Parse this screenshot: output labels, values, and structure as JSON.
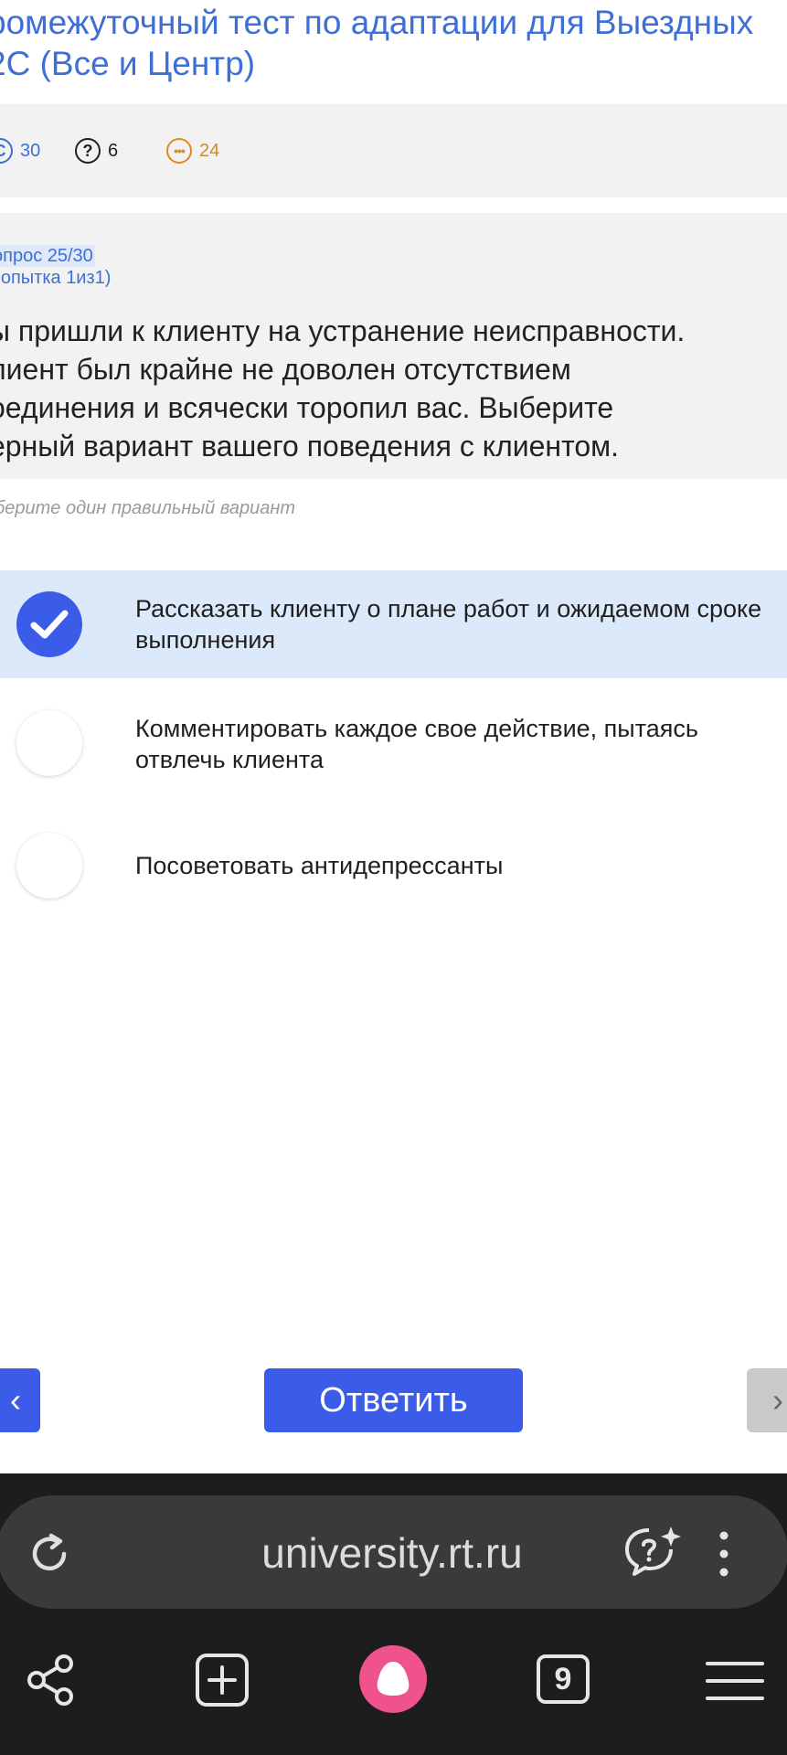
{
  "page": {
    "title": "ромежуточный тест по адаптации для Выездных\n2С (Все и Центр)"
  },
  "stats": {
    "questions_total": "30",
    "unanswered": "6",
    "remaining": "24"
  },
  "question": {
    "number": "опрос 25/30",
    "attempt": "попытка 1из1)",
    "text": "ы пришли к клиенту на устранение неисправности.\nлиент был крайне не доволен отсутствием\nоединения и всячески торопил вас. Выберите\nерный вариант вашего поведения с клиентом.",
    "hint": "берите один правильный вариант"
  },
  "options": [
    {
      "label": "Рассказать клиенту о плане работ и ожидаемом сроке выполнения",
      "selected": true
    },
    {
      "label": "Комментировать каждое свое действие, пытаясь отвлечь клиента",
      "selected": false
    },
    {
      "label": "Посоветовать антидепрессанты",
      "selected": false
    }
  ],
  "actions": {
    "submit_label": "Ответить",
    "prev_glyph": "‹",
    "next_glyph": "›"
  },
  "browser": {
    "url": "university.rt.ru",
    "tab_count": "9"
  },
  "colors": {
    "accent": "#3a5ce8",
    "link": "#3d6fd6",
    "selected_bg": "#dce9fb"
  }
}
